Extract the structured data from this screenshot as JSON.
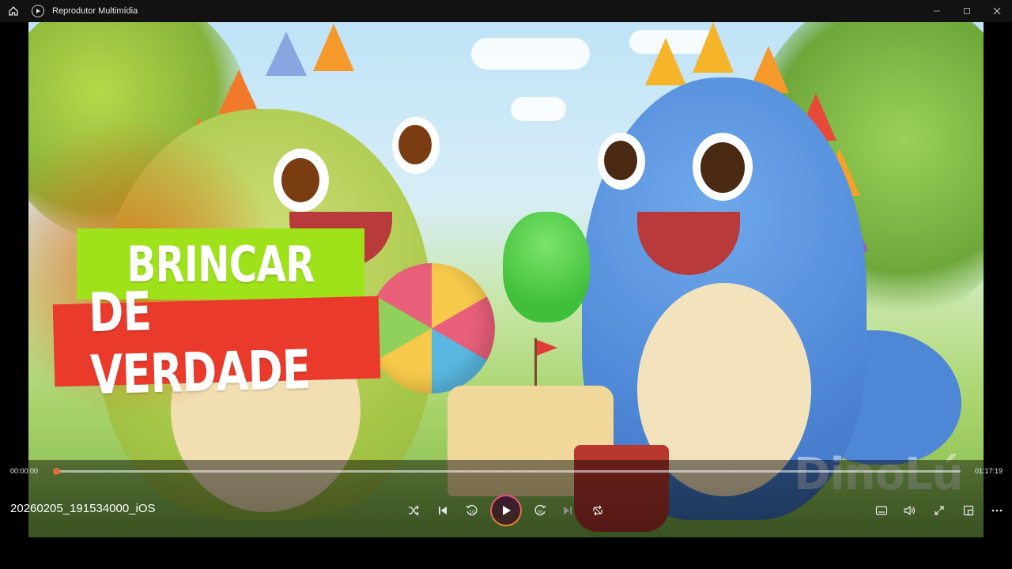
{
  "titlebar": {
    "app_title": "Reprodutor Multimídia",
    "icons": [
      "home-icon",
      "media-player-icon",
      "minimize-icon",
      "maximize-icon",
      "close-icon"
    ]
  },
  "video": {
    "title_line1": "BRINCAR",
    "title_line2": "DE VERDADE",
    "watermark": "DinoLú",
    "colors": {
      "banner_green": "#9fe21a",
      "banner_red": "#ea3a2c"
    }
  },
  "player": {
    "current_time": "00:00:00",
    "total_time": "01:17:19",
    "progress_fraction": 0.0,
    "filename": "20260205_191534000_iOS",
    "accent_color": "#e0703a",
    "controls": [
      "shuffle-icon",
      "previous-icon",
      "rewind-10-icon",
      "play-icon",
      "forward-30-icon",
      "next-icon",
      "repeat-icon"
    ],
    "right_controls": [
      "captions-icon",
      "volume-icon",
      "fullscreen-icon",
      "miniplayer-icon",
      "more-icon"
    ],
    "rewind_label": "10",
    "forward_label": "30"
  }
}
